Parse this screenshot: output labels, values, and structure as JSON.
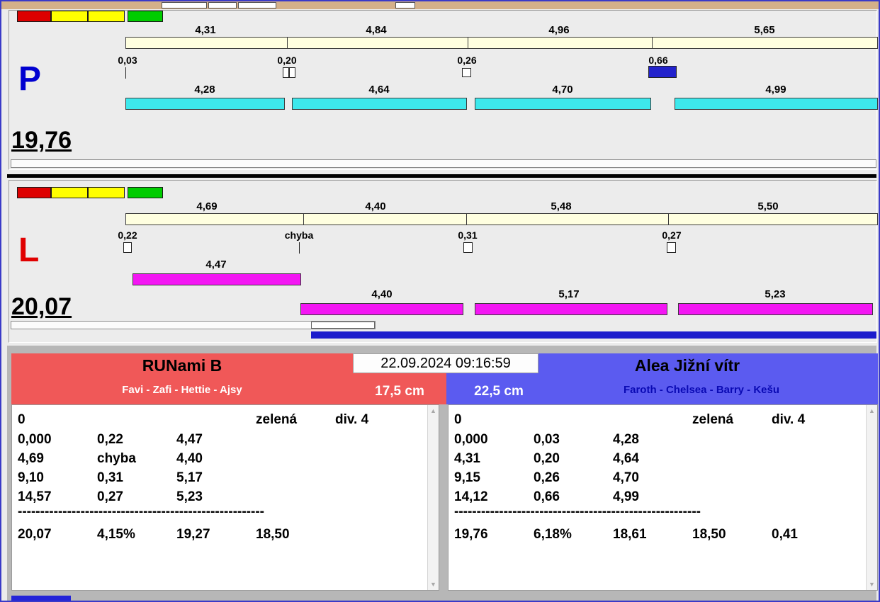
{
  "lane_p": {
    "letter": "P",
    "total": "19,76",
    "split_labels": [
      "4,31",
      "4,84",
      "4,96",
      "5,65"
    ],
    "change_labels": [
      "0,03",
      "0,20",
      "0,26",
      "0,66"
    ],
    "run_labels": [
      "4,28",
      "4,64",
      "4,70",
      "4,99"
    ]
  },
  "lane_l": {
    "letter": "L",
    "total": "20,07",
    "split_labels": [
      "4,69",
      "4,40",
      "5,48",
      "5,50"
    ],
    "change_labels": [
      "0,22",
      "chyba",
      "0,31",
      "0,27"
    ],
    "first_run_label": "4,47",
    "run_labels": [
      "4,40",
      "5,17",
      "5,23"
    ]
  },
  "scoreboard": {
    "timestamp": "22.09.2024 09:16:59",
    "left": {
      "team": "RUNami B",
      "dogs": "Favi - Zafi - Hettie - Ajsy",
      "height": "17,5 cm",
      "status": "0",
      "light": "zelená",
      "division": "div. 4",
      "rows": [
        [
          "0,000",
          "0,22",
          "4,47"
        ],
        [
          "4,69",
          "chyba",
          "4,40"
        ],
        [
          "9,10",
          "0,31",
          "5,17"
        ],
        [
          "14,57",
          "0,27",
          "5,23"
        ]
      ],
      "divider": "-------------------------------------------------------",
      "totals": [
        "20,07",
        "4,15%",
        "19,27",
        "18,50"
      ]
    },
    "right": {
      "team": "Alea Jižní vítr",
      "dogs": "Faroth - Chelsea - Barry - Kešu",
      "height": "22,5 cm",
      "status": "0",
      "light": "zelená",
      "division": "div. 4",
      "rows": [
        [
          "0,000",
          "0,03",
          "4,28"
        ],
        [
          "4,31",
          "0,20",
          "4,64"
        ],
        [
          "9,15",
          "0,26",
          "4,70"
        ],
        [
          "14,12",
          "0,66",
          "4,99"
        ]
      ],
      "divider": "-------------------------------------------------------",
      "totals": [
        "19,76",
        "6,18%",
        "18,61",
        "18,50",
        "0,41"
      ]
    }
  },
  "colors": {
    "lane_p_letter": "#0000d0",
    "lane_l_letter": "#e00000",
    "split_bar": "#ffffe0",
    "run_bar_p": "#3de8ec",
    "run_bar_l": "#f316f3",
    "marker_blue": "#2222cc",
    "status_red": "#dd0000",
    "status_yellow": "#ffff00",
    "status_green": "#00cc00",
    "team_left_bg": "#f05858",
    "team_right_bg": "#5b5bf0",
    "window_border": "#3a3ac8"
  }
}
